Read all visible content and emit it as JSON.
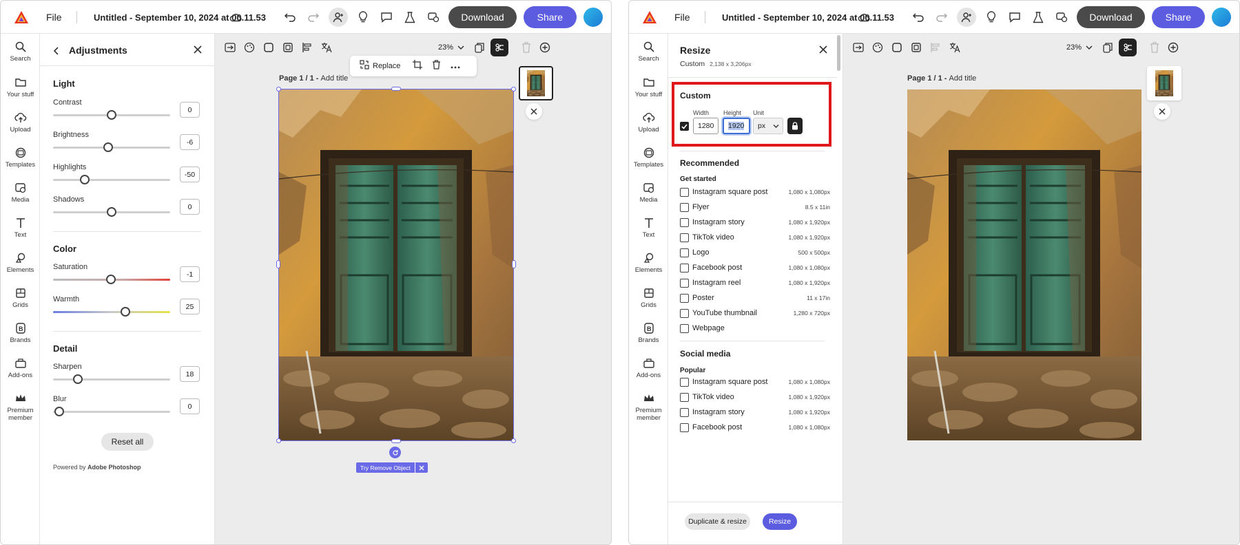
{
  "colors": {
    "accent": "#5c5ce0",
    "selection": "#6a6ae8",
    "highlight": "#e0171b",
    "download": "#4a4a4a"
  },
  "topbar": {
    "file_label": "File",
    "doc_title": "Untitled - September 10, 2024 at 00.11.53",
    "download_label": "Download",
    "share_label": "Share"
  },
  "rail": {
    "items": [
      {
        "label": "Search",
        "icon": "search-icon"
      },
      {
        "label": "Your stuff",
        "icon": "folder-icon"
      },
      {
        "label": "Upload",
        "icon": "upload-icon"
      },
      {
        "label": "Templates",
        "icon": "templates-icon"
      },
      {
        "label": "Media",
        "icon": "media-icon"
      },
      {
        "label": "Text",
        "icon": "text-icon"
      },
      {
        "label": "Elements",
        "icon": "elements-icon"
      },
      {
        "label": "Grids",
        "icon": "grids-icon"
      },
      {
        "label": "Brands",
        "icon": "brands-icon"
      },
      {
        "label": "Add-ons",
        "icon": "add-ons-icon"
      },
      {
        "label": "Premium",
        "label2": "member",
        "icon": "crown-icon"
      }
    ]
  },
  "adjust": {
    "title": "Adjustments",
    "light": "Light",
    "color": "Color",
    "detail": "Detail",
    "sliders": [
      {
        "label": "Contrast",
        "value": "0",
        "level": 0.5
      },
      {
        "label": "Brightness",
        "value": "-6",
        "level": 0.47
      },
      {
        "label": "Highlights",
        "value": "-50",
        "level": 0.27
      },
      {
        "label": "Shadows",
        "value": "0",
        "level": 0.5
      },
      {
        "label": "Saturation",
        "value": "-1",
        "level": 0.495
      },
      {
        "label": "Warmth",
        "value": "25",
        "level": 0.615
      },
      {
        "label": "Sharpen",
        "value": "18",
        "level": 0.21
      },
      {
        "label": "Blur",
        "value": "0",
        "level": 0.05
      }
    ],
    "reset_label": "Reset all",
    "powered_prefix": "Powered by ",
    "powered_brand": "Adobe Photoshop"
  },
  "canvas": {
    "zoom": "23%",
    "page_label": "Page 1 / 1 - ",
    "add_title": "Add title",
    "replace_label": "Replace",
    "try_remove": "Try Remove Object"
  },
  "resize": {
    "title": "Resize",
    "current_prefix": "Custom",
    "current_size": "2,138 x 3,206px",
    "custom_title": "Custom",
    "width_label": "Width",
    "height_label": "Height",
    "unit_label": "Unit",
    "width_value": "1280",
    "height_value": "1920",
    "unit_value": "px",
    "recommended": "Recommended",
    "get_started": "Get started",
    "get_started_items": [
      {
        "name": "Instagram square post",
        "size": "1,080 x 1,080px"
      },
      {
        "name": "Flyer",
        "size": "8.5 x 11in"
      },
      {
        "name": "Instagram story",
        "size": "1,080 x 1,920px"
      },
      {
        "name": "TikTok video",
        "size": "1,080 x 1,920px"
      },
      {
        "name": "Logo",
        "size": "500 x 500px"
      },
      {
        "name": "Facebook post",
        "size": "1,080 x 1,080px"
      },
      {
        "name": "Instagram reel",
        "size": "1,080 x 1,920px"
      },
      {
        "name": "Poster",
        "size": "11 x 17in"
      },
      {
        "name": "YouTube thumbnail",
        "size": "1,280 x 720px"
      },
      {
        "name": "Webpage",
        "size": ""
      }
    ],
    "social_media": "Social media",
    "popular": "Popular",
    "popular_items": [
      {
        "name": "Instagram square post",
        "size": "1,080 x 1,080px"
      },
      {
        "name": "TikTok video",
        "size": "1,080 x 1,920px"
      },
      {
        "name": "Instagram story",
        "size": "1,080 x 1,920px"
      },
      {
        "name": "Facebook post",
        "size": "1,080 x 1,080px"
      }
    ],
    "dup_resize_label": "Duplicate & resize",
    "resize_label": "Resize"
  }
}
